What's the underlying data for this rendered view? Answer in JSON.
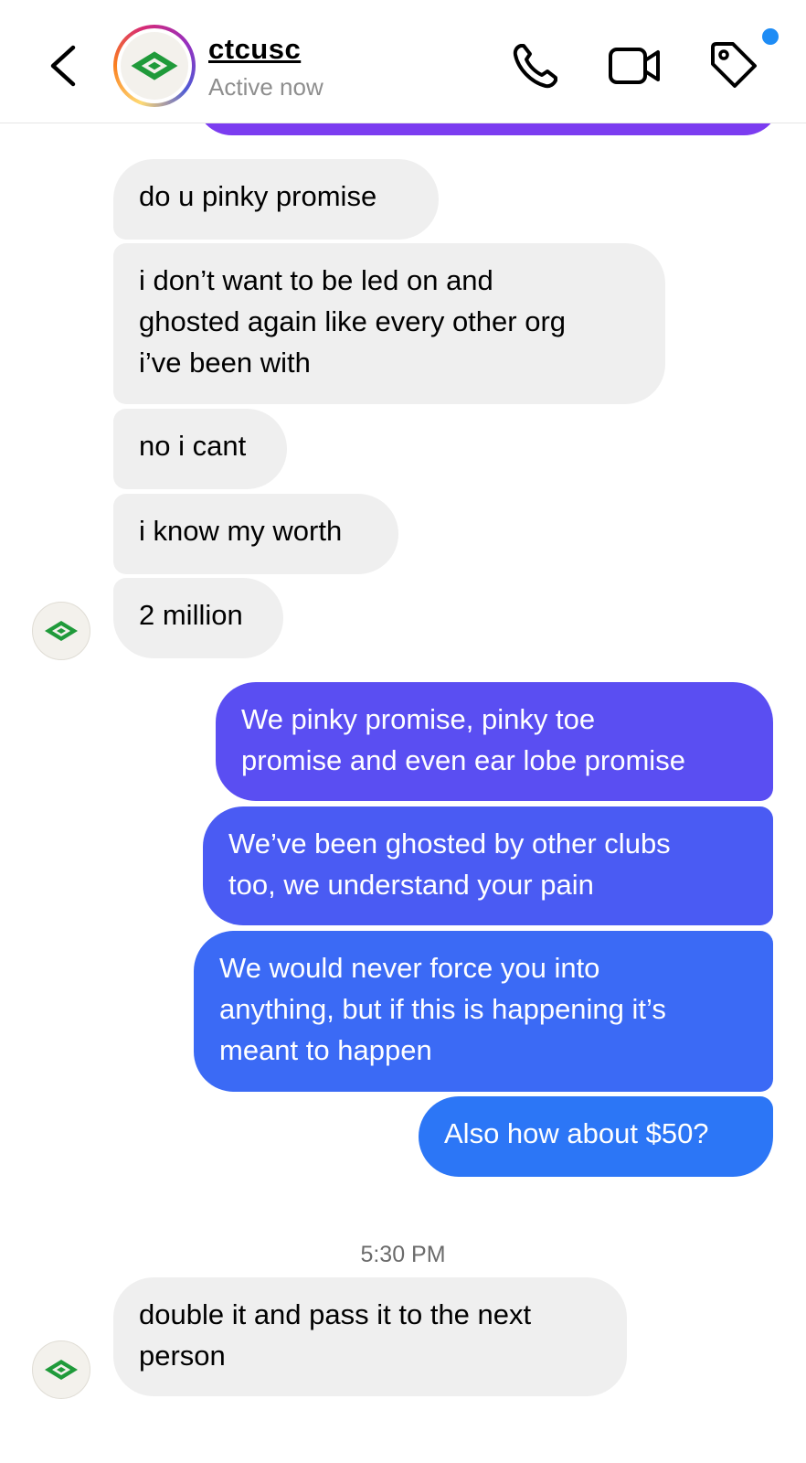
{
  "header": {
    "username": "ctcusc",
    "status": "Active now"
  },
  "messages": [
    {
      "side": "in",
      "text": "do u pinky promise"
    },
    {
      "side": "in",
      "text": "i don’t want to be led on and\nghosted again like every other org\ni’ve been with"
    },
    {
      "side": "in",
      "text": "no i cant"
    },
    {
      "side": "in",
      "text": "i know my worth"
    },
    {
      "side": "in",
      "text": "2 million"
    },
    {
      "side": "out",
      "text": "We pinky promise, pinky toe\npromise and even ear lobe promise"
    },
    {
      "side": "out",
      "text": "We’ve been ghosted by other clubs\ntoo, we understand your pain"
    },
    {
      "side": "out",
      "text": "We would never force you into\nanything, but if this is happening it’s\nmeant to happen"
    },
    {
      "side": "out",
      "text": "Also how about $50?"
    },
    {
      "side": "in",
      "text": "double it and pass it to the next\nperson"
    }
  ],
  "timestamp": "5:30 PM",
  "colors": {
    "incoming_bubble": "#efefef",
    "outgoing_gradient_top": "#5b4cf2",
    "outgoing_gradient_bottom": "#2b76f6",
    "notification_dot": "#1e8cf5",
    "logo_green": "#1f9a3a"
  },
  "icons": {
    "back": "chevron-left-icon",
    "call": "phone-icon",
    "video": "video-camera-icon",
    "tag": "tag-icon"
  }
}
